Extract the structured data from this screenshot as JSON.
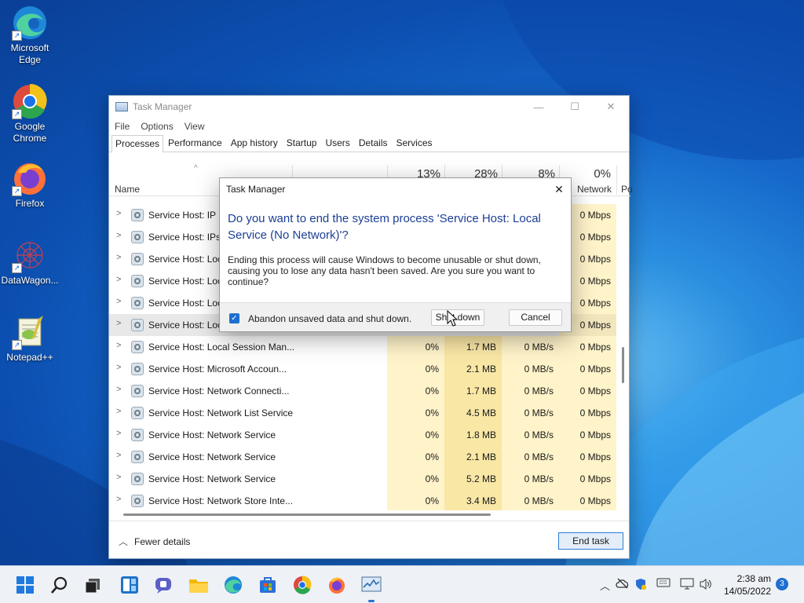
{
  "desktop": {
    "icons": [
      {
        "label": "Microsoft Edge"
      },
      {
        "label": "Google Chrome"
      },
      {
        "label": "Firefox"
      },
      {
        "label": "DataWagon..."
      },
      {
        "label": "Notepad++"
      }
    ],
    "shortcut_arrow": "↗"
  },
  "task_manager": {
    "title": "Task Manager",
    "window_buttons": {
      "minimize": "—",
      "maximize": "☐",
      "close": "✕"
    },
    "menu": [
      "File",
      "Options",
      "View"
    ],
    "tabs": [
      "Processes",
      "Performance",
      "App history",
      "Startup",
      "Users",
      "Details",
      "Services"
    ],
    "active_tab": "Processes",
    "headers": {
      "sort_indicator": "^",
      "name": "Name",
      "network_pct": "0%",
      "disk_pct": "8%",
      "memory_pct": "28%",
      "cpu_pct": "13%",
      "network": "Network",
      "power": "Po"
    },
    "rows": [
      {
        "name": "Service Host: IP H",
        "cpu": "",
        "mem": "",
        "disk": "",
        "net": "0 Mbps"
      },
      {
        "name": "Service Host: IPse",
        "cpu": "",
        "mem": "",
        "disk": "",
        "net": "0 Mbps"
      },
      {
        "name": "Service Host: Loc",
        "cpu": "",
        "mem": "",
        "disk": "",
        "net": "0 Mbps"
      },
      {
        "name": "Service Host: Loc",
        "cpu": "",
        "mem": "",
        "disk": "",
        "net": "0 Mbps"
      },
      {
        "name": "Service Host: Loc",
        "cpu": "",
        "mem": "",
        "disk": "",
        "net": "0 Mbps"
      },
      {
        "name": "Service Host: Loc",
        "cpu": "",
        "mem": "",
        "disk": "",
        "net": "0 Mbps"
      },
      {
        "name": "Service Host: Local Session Man...",
        "cpu": "0%",
        "mem": "1.7 MB",
        "disk": "0 MB/s",
        "net": "0 Mbps"
      },
      {
        "name": "Service Host: Microsoft Accoun...",
        "cpu": "0%",
        "mem": "2.1 MB",
        "disk": "0 MB/s",
        "net": "0 Mbps"
      },
      {
        "name": "Service Host: Network Connecti...",
        "cpu": "0%",
        "mem": "1.7 MB",
        "disk": "0 MB/s",
        "net": "0 Mbps"
      },
      {
        "name": "Service Host: Network List Service",
        "cpu": "0%",
        "mem": "4.5 MB",
        "disk": "0 MB/s",
        "net": "0 Mbps"
      },
      {
        "name": "Service Host: Network Service",
        "cpu": "0%",
        "mem": "1.8 MB",
        "disk": "0 MB/s",
        "net": "0 Mbps"
      },
      {
        "name": "Service Host: Network Service",
        "cpu": "0%",
        "mem": "2.1 MB",
        "disk": "0 MB/s",
        "net": "0 Mbps"
      },
      {
        "name": "Service Host: Network Service",
        "cpu": "0%",
        "mem": "5.2 MB",
        "disk": "0 MB/s",
        "net": "0 Mbps"
      },
      {
        "name": "Service Host: Network Store Inte...",
        "cpu": "0%",
        "mem": "3.4 MB",
        "disk": "0 MB/s",
        "net": "0 Mbps"
      }
    ],
    "fewer_details": "Fewer details",
    "end_task": "End task"
  },
  "dialog": {
    "title": "Task Manager",
    "close": "✕",
    "heading": "Do you want to end the system process 'Service Host: Local Service (No Network)'?",
    "body": "Ending this process will cause Windows to become unusable or shut down, causing you to lose any data hasn't been saved. Are you sure you want to continue?",
    "checkbox_label": "Abandon unsaved data and shut down.",
    "checkbox_checked": true,
    "shutdown_button": "Shut down",
    "cancel_button": "Cancel"
  },
  "taskbar": {
    "apps": [
      "start-icon",
      "search-icon",
      "task-view-icon",
      "widgets-icon",
      "teams-chat-icon",
      "file-explorer-icon",
      "edge-icon",
      "store-icon",
      "chrome-icon",
      "firefox-icon",
      "task-manager-icon"
    ],
    "clock_time": "2:38 am",
    "clock_date": "14/05/2022",
    "notification_count": "3"
  },
  "colors": {
    "accent": "#1f6fd1",
    "dialog_heading": "#1c3f94",
    "heat_light": "#fff3c9",
    "heat_dark": "#f9e7a6"
  }
}
